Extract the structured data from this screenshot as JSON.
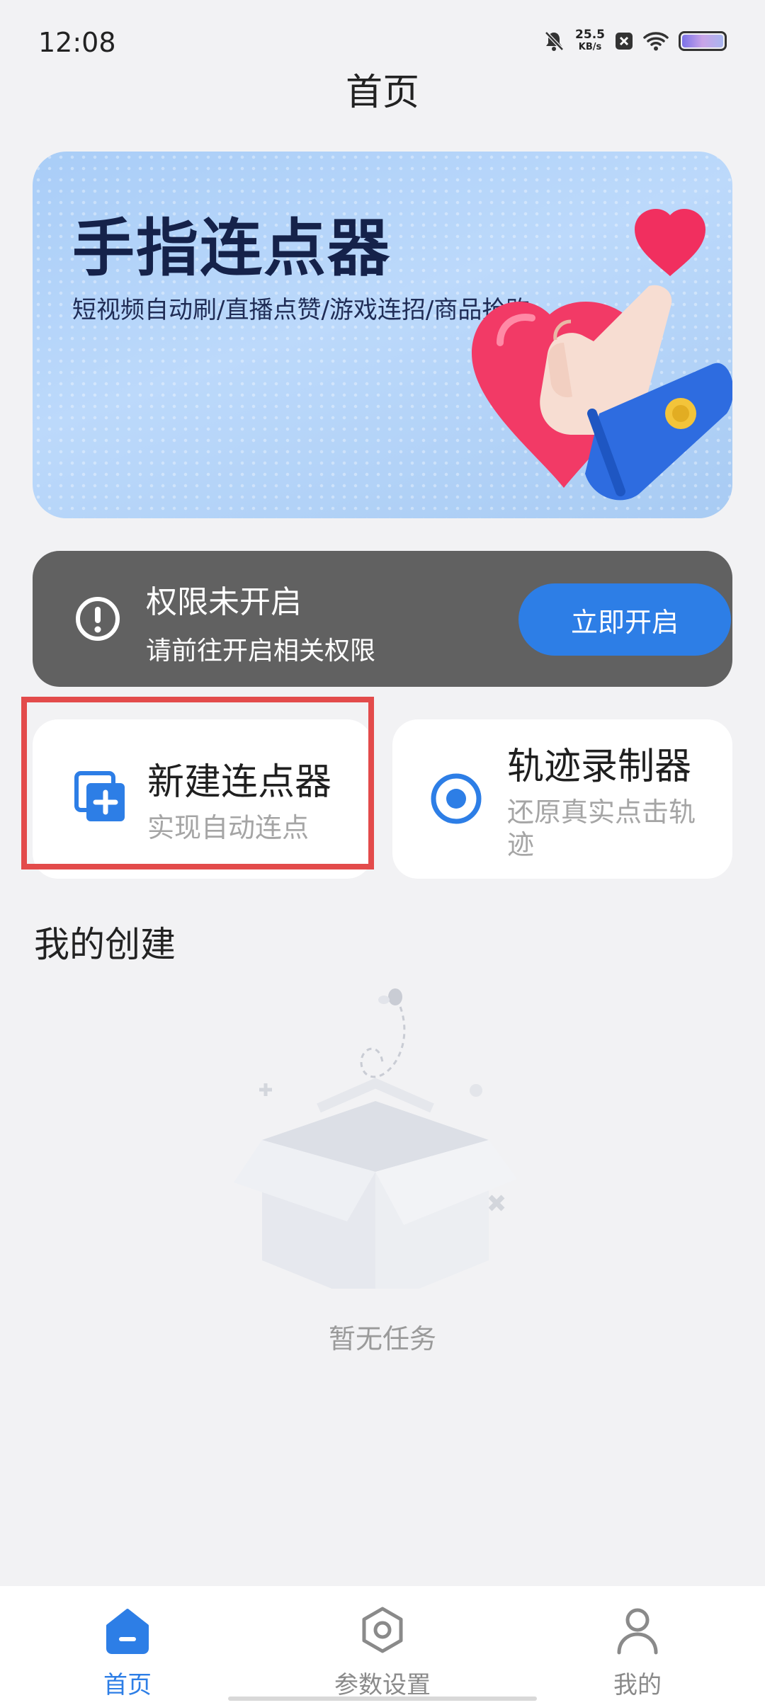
{
  "status_bar": {
    "time": "12:08",
    "net_speed_value": "25.5",
    "net_speed_unit": "KB/s",
    "icons": [
      "bell-off-icon",
      "close-box-icon",
      "wifi-icon",
      "battery-icon"
    ]
  },
  "header": {
    "title": "首页"
  },
  "banner": {
    "title": "手指连点器",
    "subtitle": "短视频自动刷/直播点赞/游戏连招/商品抢购"
  },
  "permission_card": {
    "title": "权限未开启",
    "subtitle": "请前往开启相关权限",
    "button_label": "立即开启",
    "icon": "alert-circle-icon"
  },
  "features": {
    "new_clicker": {
      "title": "新建连点器",
      "subtitle": "实现自动连点",
      "icon": "add-copy-icon",
      "highlighted": true
    },
    "track_recorder": {
      "title": "轨迹录制器",
      "subtitle": "还原真实点击轨迹",
      "icon": "record-icon"
    }
  },
  "my_creations": {
    "title": "我的创建",
    "empty_text": "暂无任务"
  },
  "bottom_nav": {
    "items": [
      {
        "label": "首页",
        "icon": "home-icon",
        "active": true
      },
      {
        "label": "参数设置",
        "icon": "settings-hex-icon",
        "active": false
      },
      {
        "label": "我的",
        "icon": "profile-icon",
        "active": false
      }
    ]
  },
  "colors": {
    "accent": "#2d7ee6",
    "background": "#f2f2f4",
    "permission_card_bg": "#616161",
    "highlight_border": "#e34b4b"
  }
}
